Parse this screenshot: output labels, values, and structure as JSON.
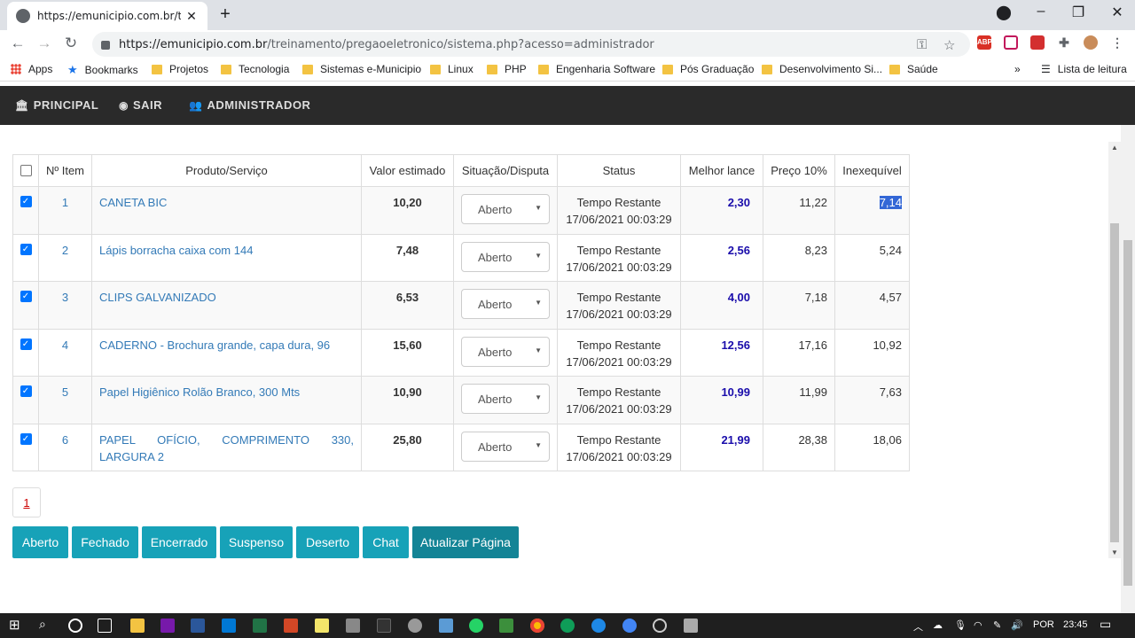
{
  "browser": {
    "tab_title": "https://emunicipio.com.br/treina",
    "url_domain": "https://emunicipio.com.br",
    "url_path": "/treinamento/pregaoeletronico/sistema.php?acesso=administrador",
    "bookmarks": [
      {
        "label": "Apps"
      },
      {
        "label": "Bookmarks"
      },
      {
        "label": "Projetos"
      },
      {
        "label": "Tecnologia"
      },
      {
        "label": "Sistemas e-Municipio"
      },
      {
        "label": "Linux"
      },
      {
        "label": "PHP"
      },
      {
        "label": "Engenharia Software"
      },
      {
        "label": "Pós Graduação"
      },
      {
        "label": "Desenvolvimento Si..."
      },
      {
        "label": "Saúde"
      }
    ],
    "reading_list": "Lista de leitura",
    "more": "»"
  },
  "appnav": {
    "principal": "PRINCIPAL",
    "sair": "SAIR",
    "administrador": "ADMINISTRADOR"
  },
  "table": {
    "headers": [
      "Nº Item",
      "Produto/Serviço",
      "Valor estimado",
      "Situação/Disputa",
      "Status",
      "Melhor lance",
      "Preço 10%",
      "Inexequível"
    ],
    "rows": [
      {
        "num": "1",
        "product": "CANETA BIC",
        "valor": "10,20",
        "situacao": "Aberto",
        "status1": "Tempo Restante",
        "status2": "17/06/2021 00:03:29",
        "lance": "2,30",
        "preco": "11,22",
        "inex": "7,14"
      },
      {
        "num": "2",
        "product": "Lápis borracha caixa com 144",
        "valor": "7,48",
        "situacao": "Aberto",
        "status1": "Tempo Restante",
        "status2": "17/06/2021 00:03:29",
        "lance": "2,56",
        "preco": "8,23",
        "inex": "5,24"
      },
      {
        "num": "3",
        "product": "CLIPS GALVANIZADO",
        "valor": "6,53",
        "situacao": "Aberto",
        "status1": "Tempo Restante",
        "status2": "17/06/2021 00:03:29",
        "lance": "4,00",
        "preco": "7,18",
        "inex": "4,57"
      },
      {
        "num": "4",
        "product": "CADERNO - Brochura grande, capa dura, 96",
        "valor": "15,60",
        "situacao": "Aberto",
        "status1": "Tempo Restante",
        "status2": "17/06/2021 00:03:29",
        "lance": "12,56",
        "preco": "17,16",
        "inex": "10,92"
      },
      {
        "num": "5",
        "product": "Papel Higiênico Rolão Branco, 300 Mts",
        "valor": "10,90",
        "situacao": "Aberto",
        "status1": "Tempo Restante",
        "status2": "17/06/2021 00:03:29",
        "lance": "10,99",
        "preco": "11,99",
        "inex": "7,63"
      },
      {
        "num": "6",
        "product": "PAPEL OFÍCIO, COMPRIMENTO 330, LARGURA 2",
        "valor": "25,80",
        "situacao": "Aberto",
        "status1": "Tempo Restante",
        "status2": "17/06/2021 00:03:29",
        "lance": "21,99",
        "preco": "28,38",
        "inex": "18,06"
      }
    ]
  },
  "pager": {
    "page": "1"
  },
  "buttons": {
    "aberto": "Aberto",
    "fechado": "Fechado",
    "encerrado": "Encerrado",
    "suspenso": "Suspenso",
    "deserto": "Deserto",
    "chat": "Chat",
    "atualizar": "Atualizar Página"
  },
  "taskbar": {
    "lang": "POR",
    "time": "23:45"
  },
  "colors": {
    "accent": "#17a2b8",
    "accent_dark": "#138496",
    "nav_bg": "#2a2a2a",
    "link": "#337ab7",
    "lance": "#1a0dab"
  }
}
